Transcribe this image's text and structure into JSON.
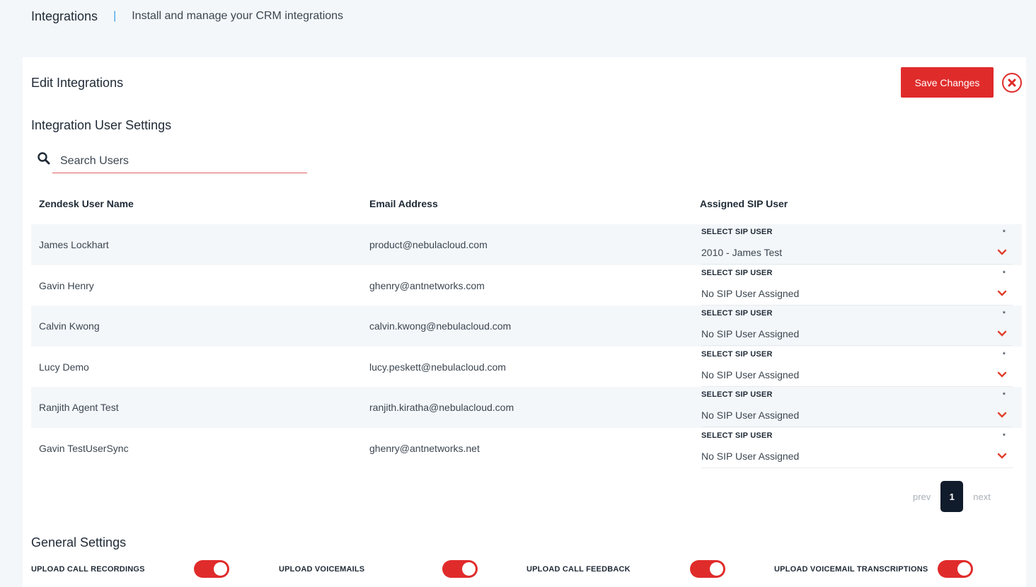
{
  "header": {
    "title": "Integrations",
    "separator": "|",
    "subtitle": "Install and manage your CRM integrations"
  },
  "card": {
    "title": "Edit Integrations",
    "save_label": "Save Changes"
  },
  "user_settings": {
    "title": "Integration User Settings",
    "search_placeholder": "Search Users",
    "columns": [
      "Zendesk User Name",
      "Email Address",
      "Assigned SIP User"
    ],
    "sip_label": "SELECT SIP USER",
    "sip_required": "*",
    "rows": [
      {
        "name": "James Lockhart",
        "email": "product@nebulacloud.com",
        "sip": "2010 - James Test"
      },
      {
        "name": "Gavin Henry",
        "email": "ghenry@antnetworks.com",
        "sip": "No SIP User Assigned"
      },
      {
        "name": "Calvin Kwong",
        "email": "calvin.kwong@nebulacloud.com",
        "sip": "No SIP User Assigned"
      },
      {
        "name": "Lucy Demo",
        "email": "lucy.peskett@nebulacloud.com",
        "sip": "No SIP User Assigned"
      },
      {
        "name": "Ranjith Agent Test",
        "email": "ranjith.kiratha@nebulacloud.com",
        "sip": "No SIP User Assigned"
      },
      {
        "name": "Gavin TestUserSync",
        "email": "ghenry@antnetworks.net",
        "sip": "No SIP User Assigned"
      }
    ]
  },
  "pagination": {
    "prev": "prev",
    "current": "1",
    "next": "next"
  },
  "general_settings": {
    "title": "General Settings",
    "toggles": [
      {
        "label": "UPLOAD CALL RECORDINGS",
        "on": true
      },
      {
        "label": "UPLOAD VOICEMAILS",
        "on": true
      },
      {
        "label": "UPLOAD CALL FEEDBACK",
        "on": true
      },
      {
        "label": "UPLOAD VOICEMAIL TRANSCRIPTIONS",
        "on": true
      }
    ]
  },
  "colors": {
    "accent": "#e02b2b",
    "separator": "#3aa0e8",
    "page_active": "#101b2b"
  }
}
